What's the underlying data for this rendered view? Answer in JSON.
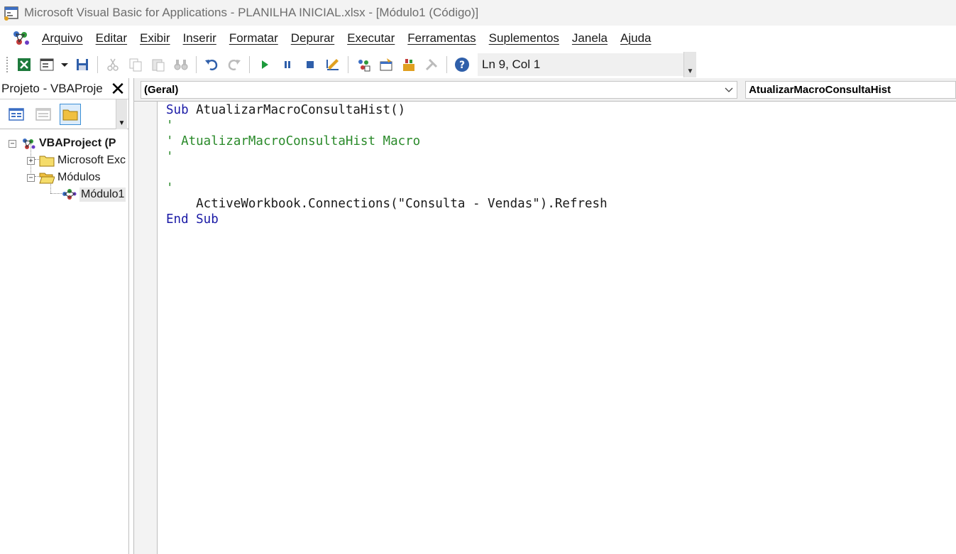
{
  "window": {
    "title": "Microsoft Visual Basic for Applications - PLANILHA INICIAL.xlsx - [Módulo1 (Código)]"
  },
  "menu": {
    "items": [
      "Arquivo",
      "Editar",
      "Exibir",
      "Inserir",
      "Formatar",
      "Depurar",
      "Executar",
      "Ferramentas",
      "Suplementos",
      "Janela",
      "Ajuda"
    ]
  },
  "toolbar": {
    "cursor_position": "Ln 9, Col 1"
  },
  "project": {
    "title": "Projeto - VBAProje",
    "close_glyph": "✕",
    "tree": {
      "root": "VBAProject (P",
      "excel_objects": "Microsoft Exc",
      "modules": "Módulos",
      "module1": "Módulo1"
    }
  },
  "code_window": {
    "object_combo": "(Geral)",
    "procedure_combo": "AtualizarMacroConsultaHist",
    "lines": [
      {
        "tokens": [
          {
            "t": "Sub",
            "c": "kw"
          },
          {
            "t": " AtualizarMacroConsultaHist()",
            "c": "tx"
          }
        ]
      },
      {
        "tokens": [
          {
            "t": "'",
            "c": "cm"
          }
        ]
      },
      {
        "tokens": [
          {
            "t": "' AtualizarMacroConsultaHist Macro",
            "c": "cm"
          }
        ]
      },
      {
        "tokens": [
          {
            "t": "'",
            "c": "cm"
          }
        ]
      },
      {
        "tokens": [
          {
            "t": "",
            "c": "tx"
          }
        ]
      },
      {
        "tokens": [
          {
            "t": "'",
            "c": "cm"
          }
        ]
      },
      {
        "tokens": [
          {
            "t": "    ActiveWorkbook.Connections(\"Consulta - Vendas\").Refresh",
            "c": "tx"
          }
        ]
      },
      {
        "tokens": [
          {
            "t": "End Sub",
            "c": "kw"
          }
        ]
      }
    ]
  },
  "colors": {
    "keyword": "#1a1aa6",
    "comment": "#2a8a2a",
    "selection_border": "#3b8fd6"
  }
}
